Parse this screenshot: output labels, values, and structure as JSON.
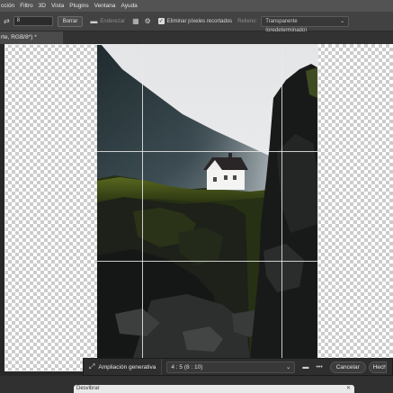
{
  "menu": [
    "cción",
    "Filtro",
    "3D",
    "Vista",
    "Plugins",
    "Ventana",
    "Ayuda"
  ],
  "options": {
    "straighten_value": "8",
    "clear_label": "Borrar",
    "straighten_label": "Enderezar",
    "delete_pixels_label": "Eliminar píxeles recortados",
    "fill_label": "Relleno:",
    "fill_value": "Transparente (predeterminado)"
  },
  "tab": {
    "title": "rte, RGB/8*) *"
  },
  "taskbar": {
    "generative_label": "Ampliación generativa",
    "ratio_value": "4 : 5 (8 : 10)",
    "cancel_label": "Cancelar",
    "done_label": "Hecho"
  },
  "dialog": {
    "title": "Desvibrar"
  },
  "colors": {
    "menubar": "#535353",
    "optionsbar": "#424242",
    "workspace": "#282828",
    "sky": "#ecedee",
    "grass": "#4e5e20"
  }
}
